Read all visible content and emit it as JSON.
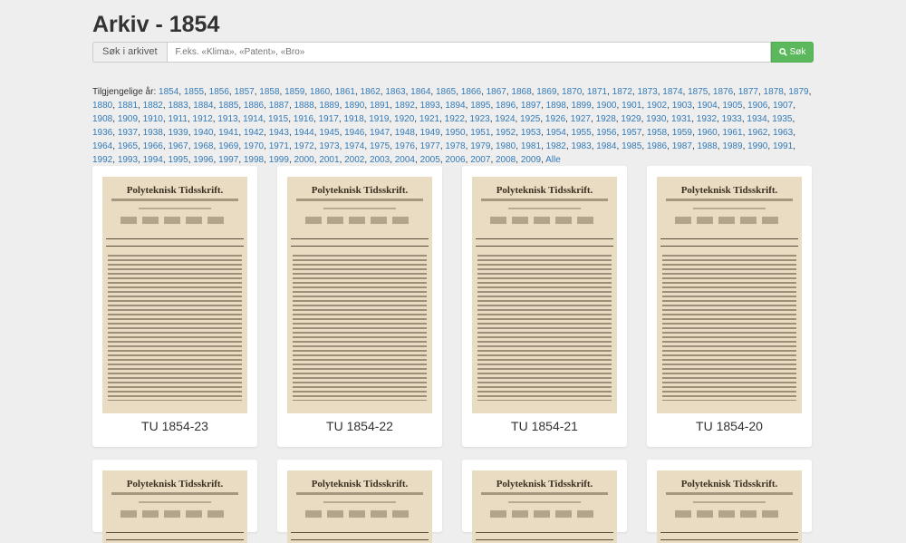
{
  "page": {
    "title": "Arkiv - 1854"
  },
  "search": {
    "addon_label": "Søk i arkivet",
    "placeholder": "F.eks. «Klima», «Patent», «Bro»",
    "button_label": "Søk",
    "button_icon": "search-icon"
  },
  "years": {
    "prefix": "Tilgjengelige år:",
    "links": [
      "1854",
      "1855",
      "1856",
      "1857",
      "1858",
      "1859",
      "1860",
      "1861",
      "1862",
      "1863",
      "1864",
      "1865",
      "1866",
      "1867",
      "1868",
      "1869",
      "1870",
      "1871",
      "1872",
      "1873",
      "1874",
      "1875",
      "1876",
      "1877",
      "1878",
      "1879",
      "1880",
      "1881",
      "1882",
      "1883",
      "1884",
      "1885",
      "1886",
      "1887",
      "1888",
      "1889",
      "1890",
      "1891",
      "1892",
      "1893",
      "1894",
      "1895",
      "1896",
      "1897",
      "1898",
      "1899",
      "1900",
      "1901",
      "1902",
      "1903",
      "1904",
      "1905",
      "1906",
      "1907",
      "1908",
      "1909",
      "1910",
      "1911",
      "1912",
      "1913",
      "1914",
      "1915",
      "1916",
      "1917",
      "1918",
      "1919",
      "1920",
      "1921",
      "1922",
      "1923",
      "1924",
      "1925",
      "1926",
      "1927",
      "1928",
      "1929",
      "1930",
      "1931",
      "1932",
      "1933",
      "1934",
      "1935",
      "1936",
      "1937",
      "1938",
      "1939",
      "1940",
      "1941",
      "1942",
      "1943",
      "1944",
      "1945",
      "1946",
      "1947",
      "1948",
      "1949",
      "1950",
      "1951",
      "1952",
      "1953",
      "1954",
      "1955",
      "1956",
      "1957",
      "1958",
      "1959",
      "1960",
      "1961",
      "1962",
      "1963",
      "1964",
      "1965",
      "1966",
      "1967",
      "1968",
      "1969",
      "1970",
      "1971",
      "1972",
      "1973",
      "1974",
      "1975",
      "1976",
      "1977",
      "1978",
      "1979",
      "1980",
      "1981",
      "1982",
      "1983",
      "1984",
      "1985",
      "1986",
      "1987",
      "1988",
      "1989",
      "1990",
      "1991",
      "1992",
      "1993",
      "1994",
      "1995",
      "1996",
      "1997",
      "1998",
      "1999",
      "2000",
      "2001",
      "2002",
      "2003",
      "2004",
      "2005",
      "2006",
      "2007",
      "2008",
      "2009",
      "Alle"
    ]
  },
  "issues": [
    {
      "label": "TU 1854-23",
      "doc_title": "Polyteknisk Tidsskrift."
    },
    {
      "label": "TU 1854-22",
      "doc_title": "Polyteknisk Tidsskrift."
    },
    {
      "label": "TU 1854-21",
      "doc_title": "Polyteknisk Tidsskrift."
    },
    {
      "label": "TU 1854-20",
      "doc_title": "Polyteknisk Tidsskrift."
    },
    {
      "label": "",
      "doc_title": "Polyteknisk Tidsskrift."
    },
    {
      "label": "",
      "doc_title": "Polyteknisk Tidsskrift."
    },
    {
      "label": "",
      "doc_title": "Polyteknisk Tidsskrift."
    },
    {
      "label": "",
      "doc_title": "Polyteknisk Tidsskrift."
    }
  ],
  "colors": {
    "link": "#337ab7",
    "button": "#5cb85c",
    "background": "#eeeeee",
    "paper": "#e9dcc3"
  }
}
